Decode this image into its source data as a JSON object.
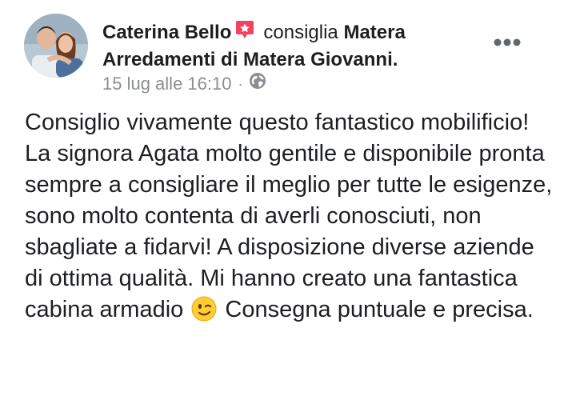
{
  "post": {
    "author_name": "Caterina Bello",
    "recommends_text": "consiglia",
    "page_name": "Matera Arredamenti di Matera Giovanni.",
    "timestamp": "15 lug alle 16:10",
    "separator": "·",
    "privacy_icon": "globe-icon",
    "recommend_icon": "recommend-badge-icon",
    "more_icon": "more-dots-icon",
    "body_text_part1": "Consiglio vivamente questo fantastico mobilificio! La signora Agata molto gentile e disponibile pronta sempre a consigliare il meglio per tutte le esigenze, sono molto contenta di averli conosciuti, non sbagliate a fidarvi! A disposizione diverse aziende di ottima qualità. Mi hanno creato una fantastica cabina armadio",
    "emoji": "winking-face-emoji",
    "body_text_part2": "Consegna puntuale e precisa."
  },
  "colors": {
    "text": "#1c1e21",
    "meta": "#8a8d91",
    "recommend_badge": "#f3425f"
  }
}
